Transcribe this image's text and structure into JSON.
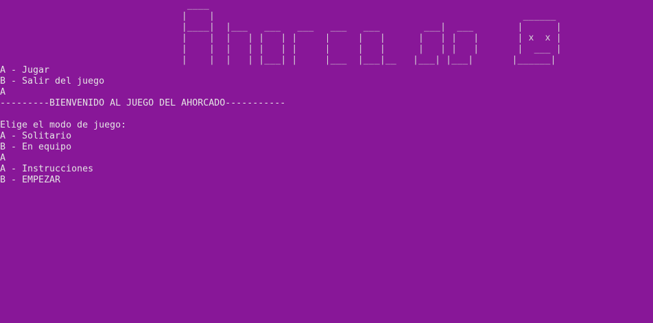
{
  "console": {
    "banner_lines": [
      "                                  ____                                                                        ",
      "                                 |    |                                                        ______          ",
      "                                 |____|  |___   ___   ___   ___   ___        ___|  ___        |      |        ",
      "                                 |    |  |   | |   | |     |     |   |      |   | |   |       | x  x |        ",
      "                                 |    |  |   | |   | |     |     |   |      |   | |   |       |  ___ |        ",
      "                                 |    |  |   | |___| |     |___  |___|__   |___| |___|       |______|        "
    ],
    "menu1": {
      "option_a": "A - Jugar",
      "option_b": "B - Salir del juego",
      "input": "A"
    },
    "welcome": "---------BIENVENIDO AL JUEGO DEL AHORCADO-----------",
    "mode_prompt": "Elige el modo de juego:",
    "mode_menu": {
      "option_a": "A - Solitario",
      "option_b": "B - En equipo",
      "input": "A"
    },
    "menu3": {
      "option_a": "A - Instrucciones",
      "option_b": "B - EMPEZAR"
    },
    "colors": {
      "background": "#881798",
      "text": "#e4e4e4"
    }
  }
}
